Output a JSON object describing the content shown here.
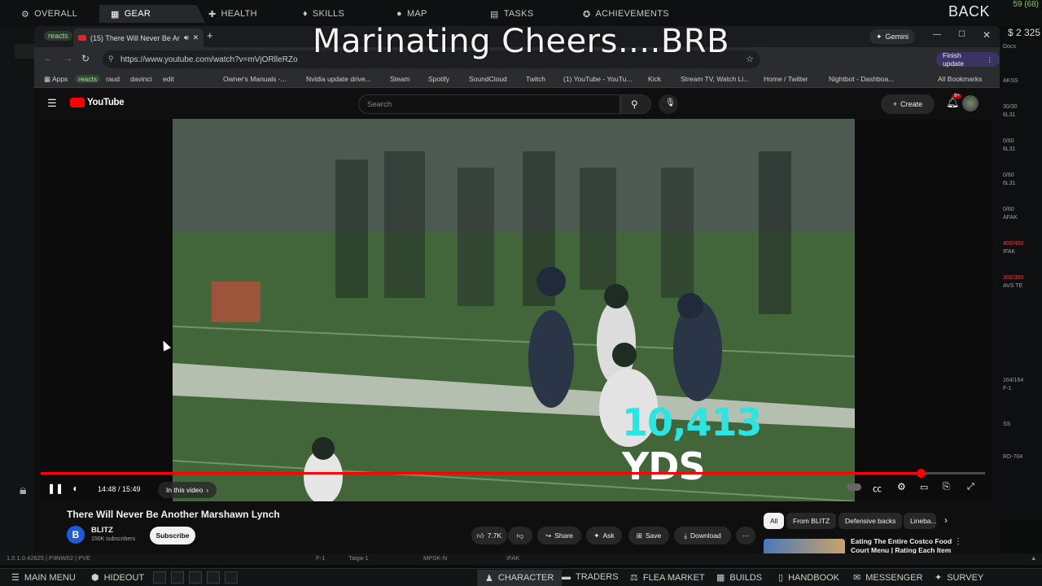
{
  "game_nav": {
    "tabs": [
      "OVERALL",
      "GEAR",
      "HEALTH",
      "SKILLS",
      "MAP",
      "TASKS",
      "ACHIEVEMENTS"
    ],
    "active_tab": "GEAR",
    "back_label": "BACK",
    "fps": "59 (68)",
    "money": "$ 2 325"
  },
  "overlay_title": "Marinating Cheers....BRB",
  "browser": {
    "tab_chip": "reacts",
    "tab_title": "(15) There Will Never Be An...",
    "gemini": "Gemini",
    "url": "https://www.youtube.com/watch?v=mVjORlleRZo",
    "finish_update": "Finish update",
    "bookmarks": [
      "Apps",
      "reacts",
      "raud",
      "davinci",
      "edit",
      "Owner's Manuals -...",
      "Nvidia update drive...",
      "Steam",
      "Spotify",
      "SoundCloud",
      "Twitch",
      "(1) YouTube - YouTu...",
      "Kick",
      "Stream TV, Watch Li...",
      "Home / Twitter",
      "Nightbot - Dashboa..."
    ],
    "all_bookmarks": "All Bookmarks"
  },
  "youtube": {
    "logo": "YouTube",
    "search_placeholder": "Search",
    "create_label": "Create",
    "notif_badge": "9+",
    "time": "14:48 / 15:49",
    "progress_fraction": 0.932,
    "in_this_video": "In this video",
    "overlay_stat": "10,413",
    "overlay_unit": "YDS",
    "video_title": "There Will Never Be Another Marshawn Lynch",
    "channel": "BLITZ",
    "subscribers": "150K subscribers",
    "subscribe": "Subscribe",
    "likes": "7.7K",
    "share": "Share",
    "ask": "Ask",
    "save": "Save",
    "download": "Download",
    "filter_chips": [
      "All",
      "From BLITZ",
      "Defensive backs",
      "Lineba..."
    ],
    "rec_title": "Eating The Entire Costco Food Court Menu | Rating Each Item",
    "rec_badge": "2"
  },
  "inventory_strip": [
    "Docs",
    "AKSS",
    "30/30",
    "6L31",
    "0/60",
    "6L31",
    "0/60",
    "6L31",
    "0/60",
    "AFAK",
    "400/400",
    "IFAK",
    "300/300",
    "AVS TE",
    "164/164",
    "F-1",
    "SS",
    "RD-704"
  ],
  "build_strip": {
    "version": "1.0.1.0.42625 | P3NW02 | PVE",
    "items": [
      "F-1",
      "Taiga-1",
      "MPSK-N",
      "IFAK"
    ]
  },
  "bottom_bar": {
    "items": [
      "MAIN MENU",
      "HIDEOUT",
      "CHARACTER",
      "TRADERS",
      "FLEA MARKET",
      "BUILDS",
      "HANDBOOK",
      "MESSENGER",
      "SURVEY"
    ],
    "active": "CHARACTER"
  },
  "colors": {
    "yt_red": "#ff0000",
    "stat_cyan": "#29e6e3",
    "fps_green": "#8ad14a"
  }
}
